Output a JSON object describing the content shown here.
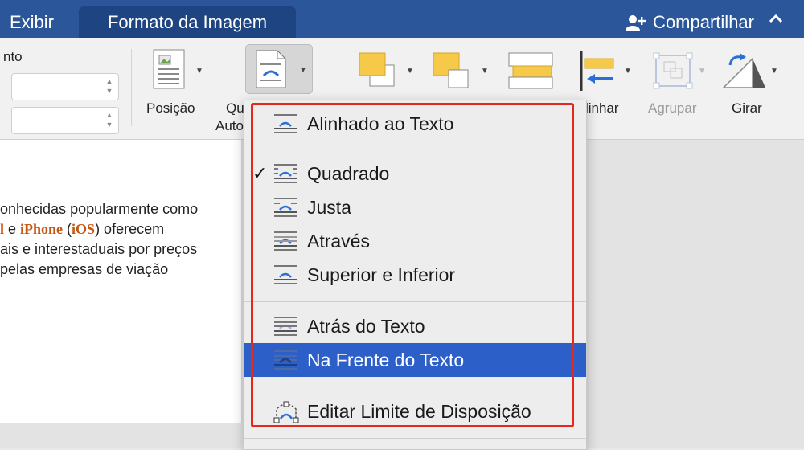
{
  "tabs": {
    "exibir": "Exibir",
    "formato": "Formato da Imagem"
  },
  "share": {
    "label": "Compartilhar",
    "icon": "add-person-icon"
  },
  "ribbon": {
    "group_label": "nto",
    "posicao": "Posição",
    "quebra_1": "Qu",
    "quebra_2": "Auto",
    "alinhar": "linhar",
    "agrupar": "Agrupar",
    "girar": "Girar"
  },
  "document": {
    "line1": "onhecidas popularmente como",
    "line2_a": "l",
    "line2_b": " e ",
    "line2_iphone": "iPhone",
    "line2_c": " (",
    "line2_ios": "iOS",
    "line2_d": ") oferecem",
    "line3": "ais e interestaduais por preços",
    "line4": "pelas empresas de viação"
  },
  "menu": {
    "items": [
      {
        "label": "Alinhado ao Texto",
        "checked": false,
        "selected": false
      },
      {
        "label": "Quadrado",
        "checked": true,
        "selected": false
      },
      {
        "label": "Justa",
        "checked": false,
        "selected": false
      },
      {
        "label": "Através",
        "checked": false,
        "selected": false
      },
      {
        "label": "Superior e Inferior",
        "checked": false,
        "selected": false
      },
      {
        "label": "Atrás do Texto",
        "checked": false,
        "selected": false
      },
      {
        "label": "Na Frente do Texto",
        "checked": false,
        "selected": true
      },
      {
        "label": "Editar Limite de Disposição",
        "checked": false,
        "selected": false
      }
    ],
    "check_mark": "✓"
  },
  "colors": {
    "tabbar": "#2b579a",
    "selection": "#2c5fc8",
    "highlight_box": "#e4281c",
    "link_orange": "#c4560f"
  }
}
